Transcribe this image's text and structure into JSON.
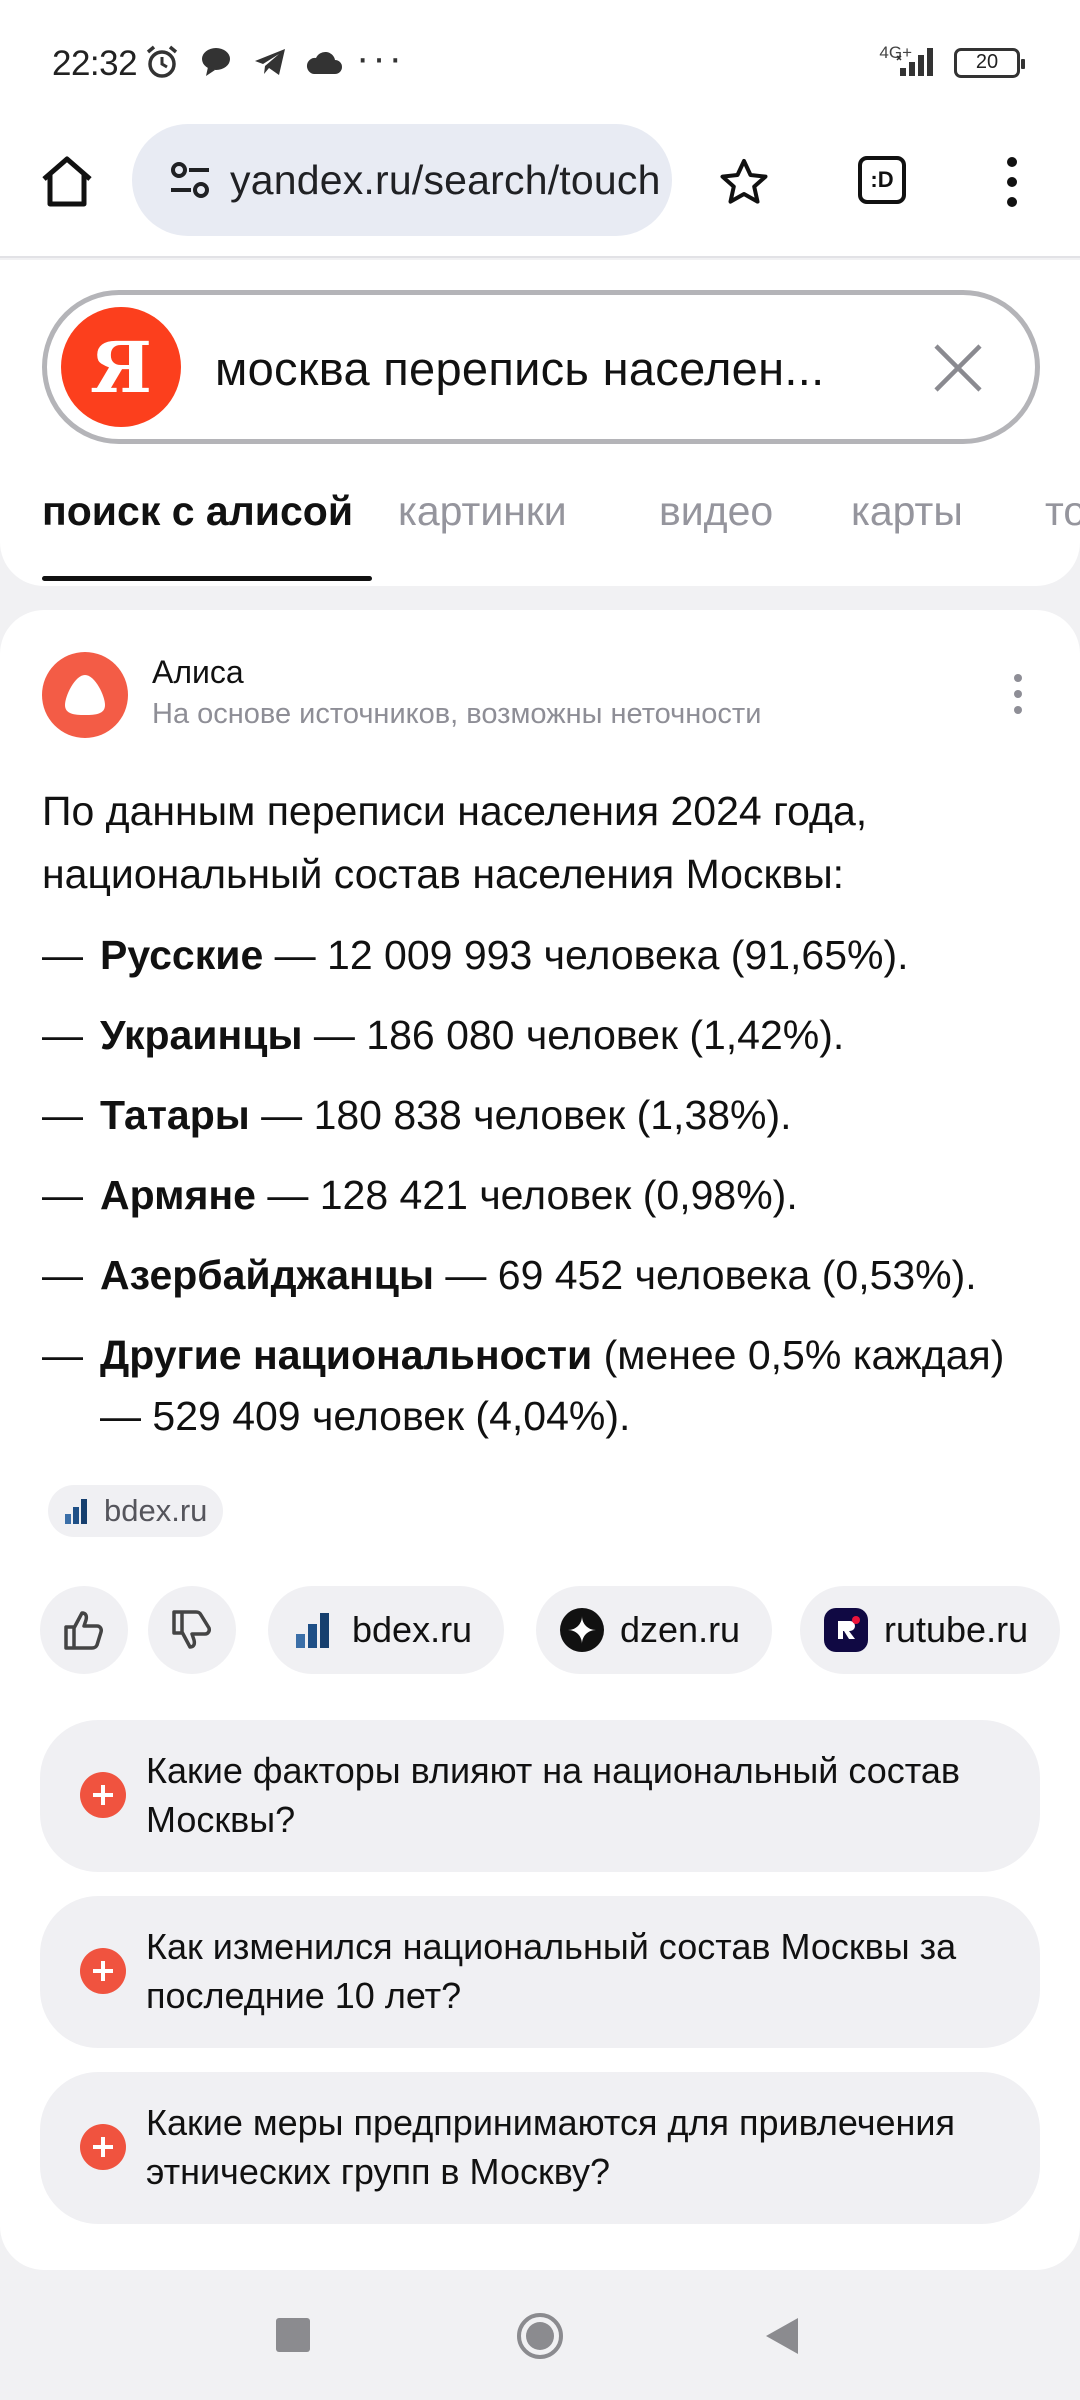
{
  "status_bar": {
    "time": "22:32",
    "more": "···",
    "network": "4G+",
    "battery": "20"
  },
  "browser": {
    "url": "yandex.ru/search/touch",
    "tab_switcher_label": ":D"
  },
  "search": {
    "logo": "Я",
    "query": "москва перепись населен..."
  },
  "tabs": [
    {
      "label": "поиск с алисой",
      "active": true
    },
    {
      "label": "картинки",
      "active": false
    },
    {
      "label": "видео",
      "active": false
    },
    {
      "label": "карты",
      "active": false
    },
    {
      "label": "то",
      "active": false
    }
  ],
  "answer": {
    "author": "Алиса",
    "disclaimer": "На основе источников, возможны неточности",
    "intro": "По данным переписи населения 2024 года, национальный состав населения Москвы:",
    "dash": "—",
    "items": [
      {
        "group": "Русские",
        "detail": " — 12 009 993 человека (91,65%)."
      },
      {
        "group": "Украинцы",
        "detail": " — 186 080 человек (1,42%)."
      },
      {
        "group": "Татары",
        "detail": " — 180 838 человек (1,38%)."
      },
      {
        "group": "Армяне",
        "detail": " — 128 421 человек (0,98%)."
      },
      {
        "group": "Азербайджанцы",
        "detail": " — 69 452 человека (0,53%)."
      },
      {
        "group": "Другие национальности",
        "detail": " (менее 0,5% каждая) — 529 409 человек (4,04%)."
      }
    ],
    "source_chip": "bdex.ru"
  },
  "sources": [
    {
      "name": "bdex.ru",
      "icon": "bdex-icon"
    },
    {
      "name": "dzen.ru",
      "icon": "dzen-icon"
    },
    {
      "name": "rutube.ru",
      "icon": "rutube-icon"
    }
  ],
  "suggestions": [
    "Какие факторы влияют на национальный состав Москвы?",
    "Как изменился национальный состав Москвы за последние 10 лет?",
    "Какие меры предпринимаются для привлечения этнических групп в Москву?"
  ],
  "colors": {
    "yandex_red": "#fc3f1d",
    "alisa_coral": "#f35c46",
    "url_bg": "#e8ebf3",
    "chip_bg": "#f0f0f3"
  }
}
